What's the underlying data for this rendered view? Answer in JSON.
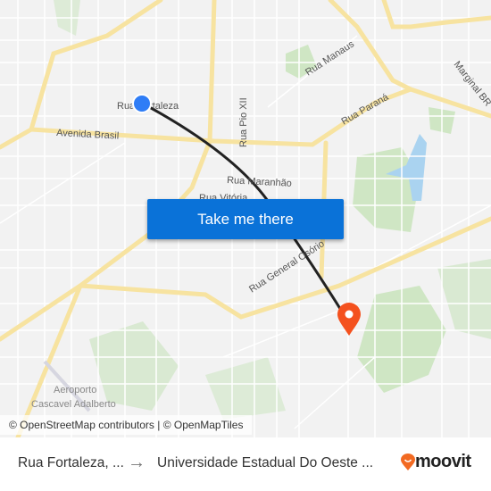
{
  "map": {
    "street_labels": {
      "rua_fortaleza": "Rua Fortaleza",
      "avenida_brasil": "Avenida Brasil",
      "rua_pio_xii": "Rua Pio XII",
      "rua_manaus": "Rua Manaus",
      "rua_parana": "Rua Paraná",
      "marginal_br": "Marginal BR",
      "rua_maranhao": "Rua Maranhão",
      "rua_vitoria": "Rua Vitória",
      "rua_general_osorio": "Rua General Osório",
      "aeroporto": "Aeroporto",
      "cascavel_adalberto": "Cascavel Adalberto"
    },
    "origin_marker_color": "#2f7df6",
    "destination_marker_color": "#f4511e",
    "take_me_there": "Take me there",
    "attribution": "© OpenStreetMap contributors | © OpenMapTiles"
  },
  "footer": {
    "from": "Rua Fortaleza, ...",
    "arrow": "→",
    "to": "Universidade Estadual Do Oeste ...",
    "brand": "moovit",
    "brand_color": "#f26a22"
  }
}
